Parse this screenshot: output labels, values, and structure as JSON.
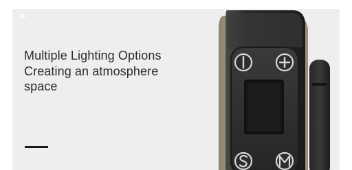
{
  "headline": {
    "line1": "Multiple Lighting Options",
    "line2": "Creating an atmosphere",
    "line3": "space"
  },
  "product": {
    "icon": "handheld-controller-photo",
    "buttons": [
      "power",
      "plus",
      "s",
      "m"
    ]
  },
  "colors": {
    "panel_background": "#eeeeee",
    "text": "#2b2b2b",
    "device_body": "#2a2a2a",
    "device_trim": "#c9b99a"
  }
}
